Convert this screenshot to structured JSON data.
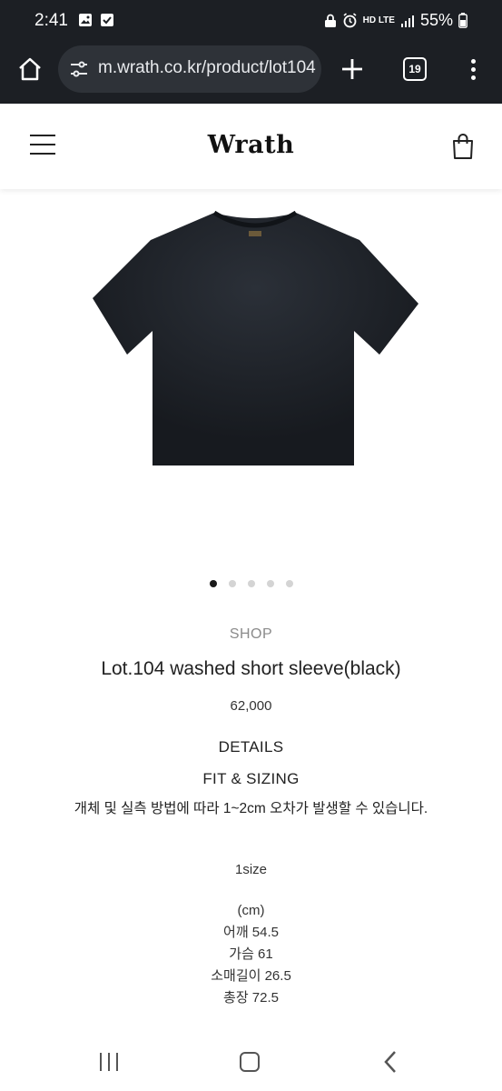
{
  "status_bar": {
    "time": "2:41",
    "network": "HD LTE",
    "battery": "55%",
    "icons": [
      "image-icon",
      "checkbox-icon",
      "lock-icon",
      "alarm-icon",
      "signal-icon",
      "battery-icon"
    ]
  },
  "browser": {
    "url": "m.wrath.co.kr/product/lot104",
    "tab_count": "19"
  },
  "site": {
    "logo": "Wrath"
  },
  "carousel": {
    "count": 5,
    "active_index": 0
  },
  "product": {
    "category": "SHOP",
    "title": "Lot.104 washed short sleeve(black)",
    "price": "62,000",
    "details_label": "DETAILS",
    "fit_label": "FIT & SIZING",
    "note": "개체 및 실측 방법에 따라 1~2cm 오차가 발생할 수 있습니다.",
    "size": "1size",
    "unit": "(cm)",
    "measurements": [
      "어깨 54.5",
      "가슴 61",
      "소매길이 26.5",
      "총장 72.5"
    ]
  },
  "colors": {
    "chrome_bg": "#1c1f24",
    "urlbar_bg": "#2e3238",
    "shirt": "#1d2128"
  }
}
